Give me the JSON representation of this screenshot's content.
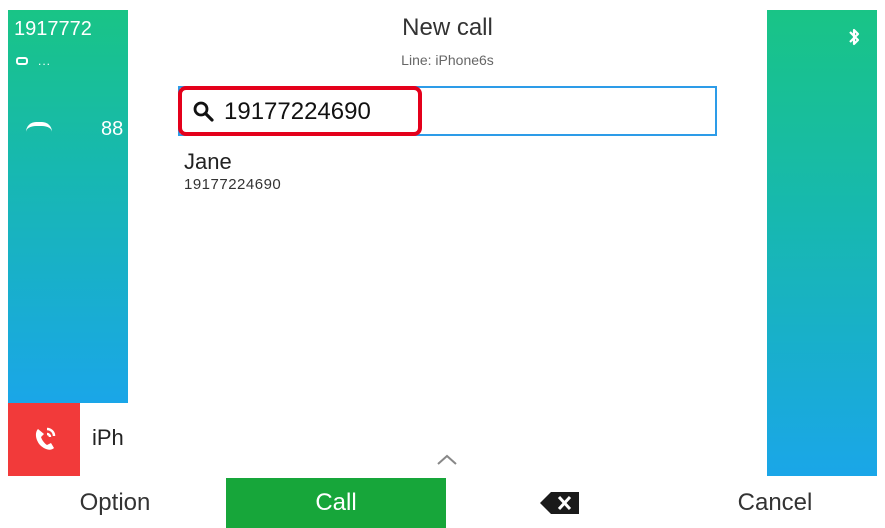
{
  "left_panel": {
    "number": "1917772",
    "sub_text": "...",
    "extension": "88"
  },
  "line_item": {
    "label": "iPh"
  },
  "dialog": {
    "title": "New call",
    "subtitle": "Line: iPhone6s",
    "search_value": "19177224690"
  },
  "results": [
    {
      "name": "Jane",
      "number": "19177224690"
    }
  ],
  "softkeys": {
    "option": "Option",
    "call": "Call",
    "cancel": "Cancel"
  },
  "colors": {
    "panel_top": "#19c486",
    "panel_bottom": "#1aa6e8",
    "call_button": "#17a63a",
    "hangup_red": "#f23a3a",
    "search_border": "#2d9ce8",
    "highlight_red": "#e4001b"
  },
  "icons": {
    "search": "search-icon",
    "bluetooth": "bluetooth-icon",
    "handset": "handset-icon",
    "backspace": "backspace-icon",
    "chevron": "chevron-up-icon"
  }
}
